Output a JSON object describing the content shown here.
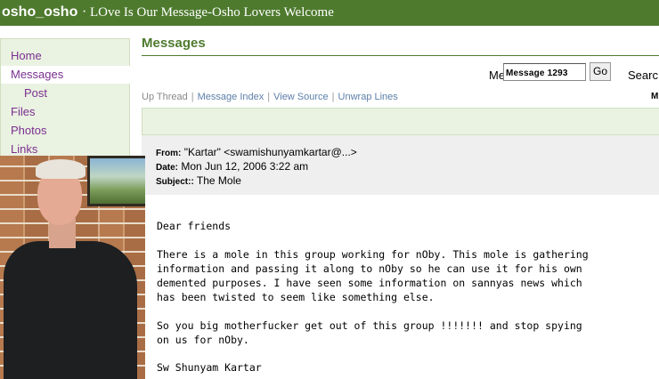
{
  "topbar": {
    "group_name": "osho_osho",
    "separator": "·",
    "description": "LOve Is Our Message-Osho Lovers Welcome"
  },
  "sidebar": {
    "items": [
      {
        "label": "Home"
      },
      {
        "label": "Messages",
        "active": true
      },
      {
        "label": "Post"
      },
      {
        "label": "Files"
      },
      {
        "label": "Photos"
      },
      {
        "label": "Links"
      }
    ]
  },
  "page": {
    "title": "Messages"
  },
  "message_nav": {
    "prefix": "Me",
    "message_field_value": "Message  1293",
    "go_label": "Go",
    "search_label": "Searc"
  },
  "links": {
    "up_thread": "Up Thread",
    "message_index": "Message Index",
    "view_source": "View Source",
    "unwrap_lines": "Unwrap Lines",
    "separator": "|",
    "edge_fragment": "M"
  },
  "header": {
    "from_label": "From:",
    "from_value": "\"Kartar\" <swamishunyamkartar@...>",
    "date_label": "Date:",
    "date_value": "Mon Jun 12, 2006  3:22 am",
    "subject_label": "Subject::",
    "subject_value": "The Mole"
  },
  "message": {
    "lines": [
      "Dear friends",
      "There is a mole in this group working for nOby. This mole is gathering",
      "information and passing it along to nOby so he can use it for his own",
      "demented purposes. I have seen some information on sannyas news which",
      "has been twisted to seem like something else.",
      "So you big motherfucker get out of this group !!!!!!! and stop spying",
      "on us for nOby.",
      "Sw Shunyam Kartar"
    ]
  },
  "colors": {
    "brand_green": "#4e7a2e",
    "nav_link": "#7a2f8f",
    "link_blue": "#5c7fa8",
    "panel_green": "#eaf2e2",
    "header_gray": "#efefef"
  },
  "icons": {
    "photo": "author-photo"
  }
}
